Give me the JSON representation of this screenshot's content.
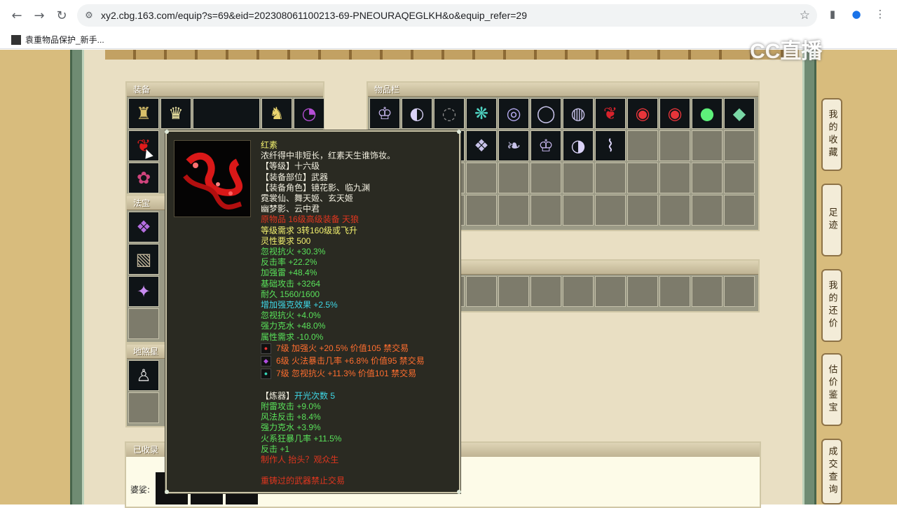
{
  "browser": {
    "url": "xy2.cbg.163.com/equip?s=69&eid=202308061100213-69-PNEOURAQEGLKH&o&equip_refer=29",
    "bookmark_label": "袁重物品保护_新手...",
    "icons": [
      "back-icon",
      "forward-icon",
      "reload-icon",
      "site-info-icon",
      "star-icon",
      "sidebar-icon",
      "profile-icon",
      "menu-icon"
    ]
  },
  "watermark": "CC直播",
  "panels": {
    "equipment": "装备",
    "inventory": "物品栏",
    "fabao": "法宝",
    "star": "地煞星",
    "collected": "已收录"
  },
  "bottom": {
    "label": "婆娑:"
  },
  "sidebar": [
    {
      "label": "我的收藏"
    },
    {
      "label": "足迹"
    },
    {
      "label": "我的还价"
    },
    {
      "label": "估价鉴宝"
    },
    {
      "label": "成交查询"
    }
  ],
  "tooltip": {
    "name": "红素",
    "desc": "浓纤得中非短长，红素天生谁饰妆。",
    "level": "【等级】十六级",
    "slot": "【装备部位】武器",
    "roles_1": "【装备角色】镜花影、临九渊",
    "roles_2": "霓裳仙、舞天姬、玄天姬",
    "roles_3": "幽梦影、云中君",
    "origin": "原物品 16级高级装备 天狼",
    "req_level": "等级需求 3转160级或飞升",
    "spirit": "灵性要求 500",
    "stats_base": [
      "忽视抗火 +30.3%",
      "反击率 +22.2%",
      "加强雷 +48.4%",
      "基础攻击 +3264",
      "耐久 1560/1600"
    ],
    "cyan_stat": "增加强克效果 +2.5%",
    "stats_extra": [
      "忽视抗火 +4.0%",
      "强力克水 +48.0%",
      "属性需求 -10.0%"
    ],
    "gems": [
      "7级 加强火 +20.5% 价值105 禁交易",
      "6级 火法暴击几率 +6.8% 价值95 禁交易",
      "7级 忽视抗火 +11.3% 价值101 禁交易"
    ],
    "refine_label": "【炼器】",
    "refine_count": "开光次数 5",
    "refine_stats": [
      "附雷攻击 +9.0%",
      "风法反击 +8.4%",
      "强力克水 +3.9%",
      "火系狂暴几率 +11.5%",
      "反击 +1"
    ],
    "maker": "制作人 抬头？观众生",
    "footer": "重铸过的武器禁止交易"
  }
}
